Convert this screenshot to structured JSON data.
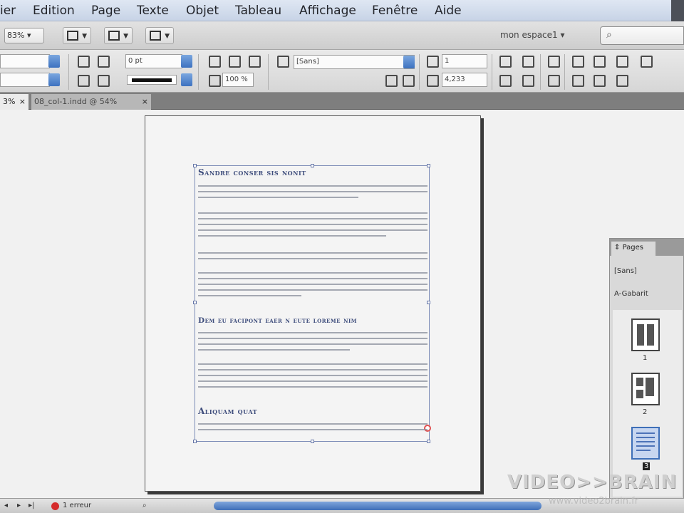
{
  "menu": [
    "ier",
    "Edition",
    "Page",
    "Texte",
    "Objet",
    "Tableau",
    "Affichage",
    "Fenêtre",
    "Aide"
  ],
  "appbar": {
    "zoom": "83%",
    "workspace": "mon espace1 ▾",
    "search_icon": "search-icon"
  },
  "control": {
    "stroke_weight": "0 pt",
    "scale": "100 %",
    "style_select": "[Sans]",
    "spacing": "1",
    "offset": "4,233"
  },
  "tabs": [
    {
      "label": "3%",
      "close": "×"
    },
    {
      "label": "08_col-1.indd @ 54%",
      "close": "×"
    }
  ],
  "document": {
    "heading1": "Sandre conser sis nonit",
    "heading2": "Dem eu facipont eaer n eute loreme nim",
    "heading3": "Aliquam quat"
  },
  "pages_panel": {
    "tab": "Pages",
    "masters": [
      "[Sans]",
      "A-Gabarit"
    ],
    "pages": [
      {
        "label": "1",
        "selected": false
      },
      {
        "label": "2",
        "selected": false
      },
      {
        "label": "3",
        "selected": true
      }
    ]
  },
  "status": {
    "errors": "1 erreur"
  },
  "watermark": {
    "brand": "VIDEO>>BRAIN",
    "url": "www.video2brain.fr"
  },
  "colors": {
    "menu_bg": "#d3dcec",
    "heading": "#3e4d7c",
    "frame": "#7c8cb7",
    "accent": "#3f6fb7",
    "error": "#d52b2b"
  }
}
